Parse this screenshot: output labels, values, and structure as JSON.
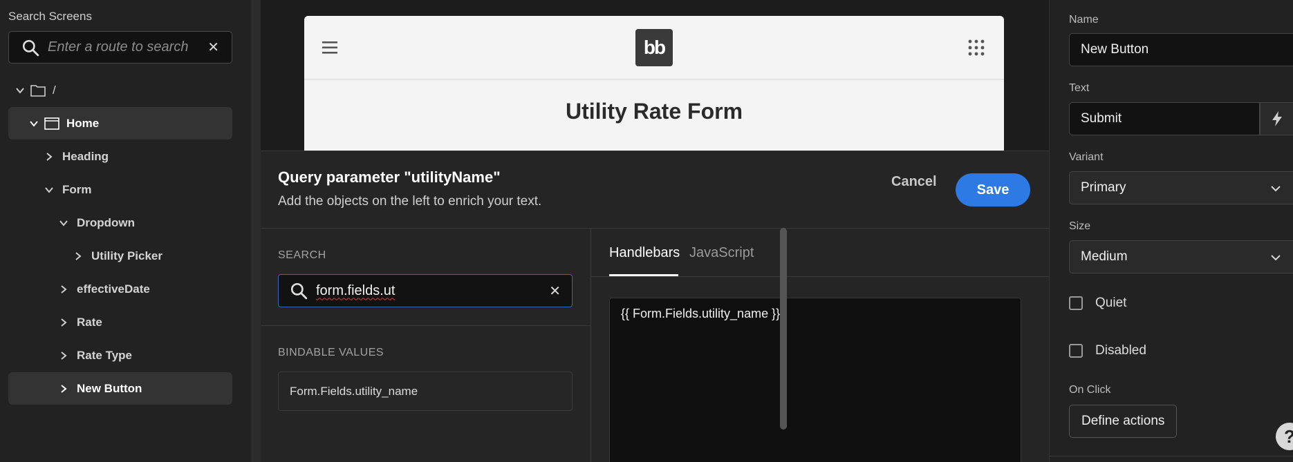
{
  "left_panel": {
    "title": "Search Screens",
    "search_placeholder": "Enter a route to search",
    "tree": [
      {
        "label": "/",
        "level": 0
      },
      {
        "label": "Home",
        "level": 1
      },
      {
        "label": "Heading",
        "level": 2
      },
      {
        "label": "Form",
        "level": 2
      },
      {
        "label": "Dropdown",
        "level": 3
      },
      {
        "label": "Utility Picker",
        "level": 4
      },
      {
        "label": "effectiveDate",
        "level": 3
      },
      {
        "label": "Rate",
        "level": 3
      },
      {
        "label": "Rate Type",
        "level": 3
      },
      {
        "label": "New Button",
        "level": 3
      }
    ]
  },
  "preview": {
    "logo_text": "bb",
    "title": "Utility Rate Form"
  },
  "modal": {
    "title": "Query parameter \"utilityName\"",
    "subtitle": "Add the objects on the left to enrich your text.",
    "cancel_label": "Cancel",
    "save_label": "Save",
    "search_label": "SEARCH",
    "search_value": "form.fields.ut",
    "bindable_label": "BINDABLE VALUES",
    "bindable_item": "Form.Fields.utility_name",
    "tabs": [
      "Handlebars",
      "JavaScript"
    ],
    "editor_value": "{{ Form.Fields.utility_name }}"
  },
  "right_panel": {
    "name_label": "Name",
    "name_value": "New Button",
    "text_label": "Text",
    "text_value": "Submit",
    "variant_label": "Variant",
    "variant_value": "Primary",
    "size_label": "Size",
    "size_value": "Medium",
    "quiet_label": "Quiet",
    "disabled_label": "Disabled",
    "onclick_label": "On Click",
    "define_actions_label": "Define actions",
    "help_label": "?"
  },
  "colors": {
    "accent": "#2d7ae5",
    "background": "#1a1a1a",
    "panel": "#222222"
  }
}
